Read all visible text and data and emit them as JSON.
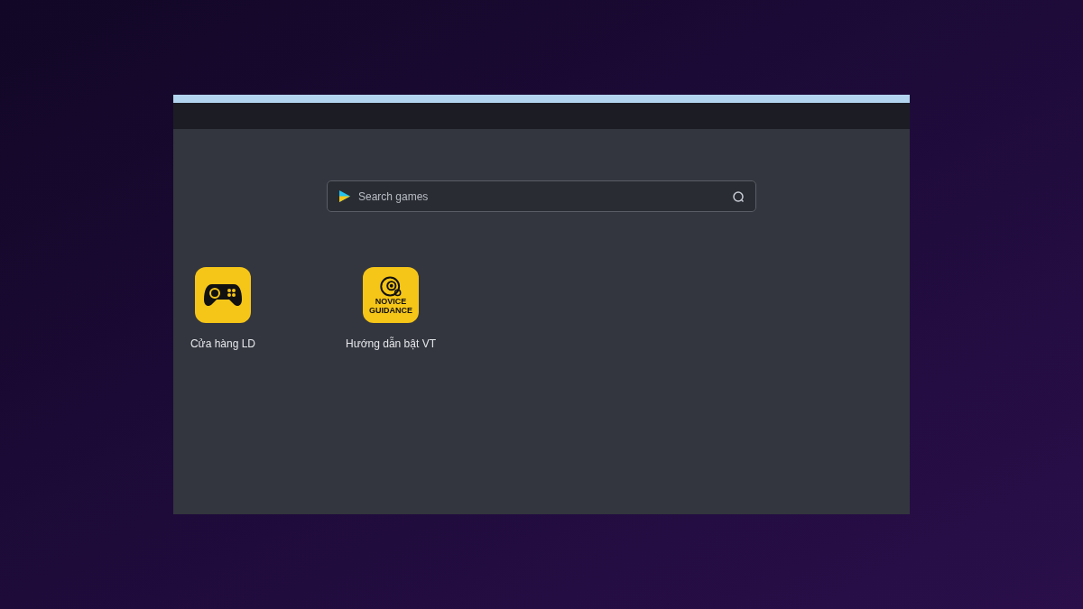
{
  "search": {
    "placeholder": "Search games"
  },
  "apps": [
    {
      "kind": "gamepad",
      "label": "Cửa hàng LD"
    },
    {
      "kind": "guidance",
      "label": "Hướng dẫn bật VT",
      "icon_text": "NOVICE GUIDANCE"
    }
  ]
}
